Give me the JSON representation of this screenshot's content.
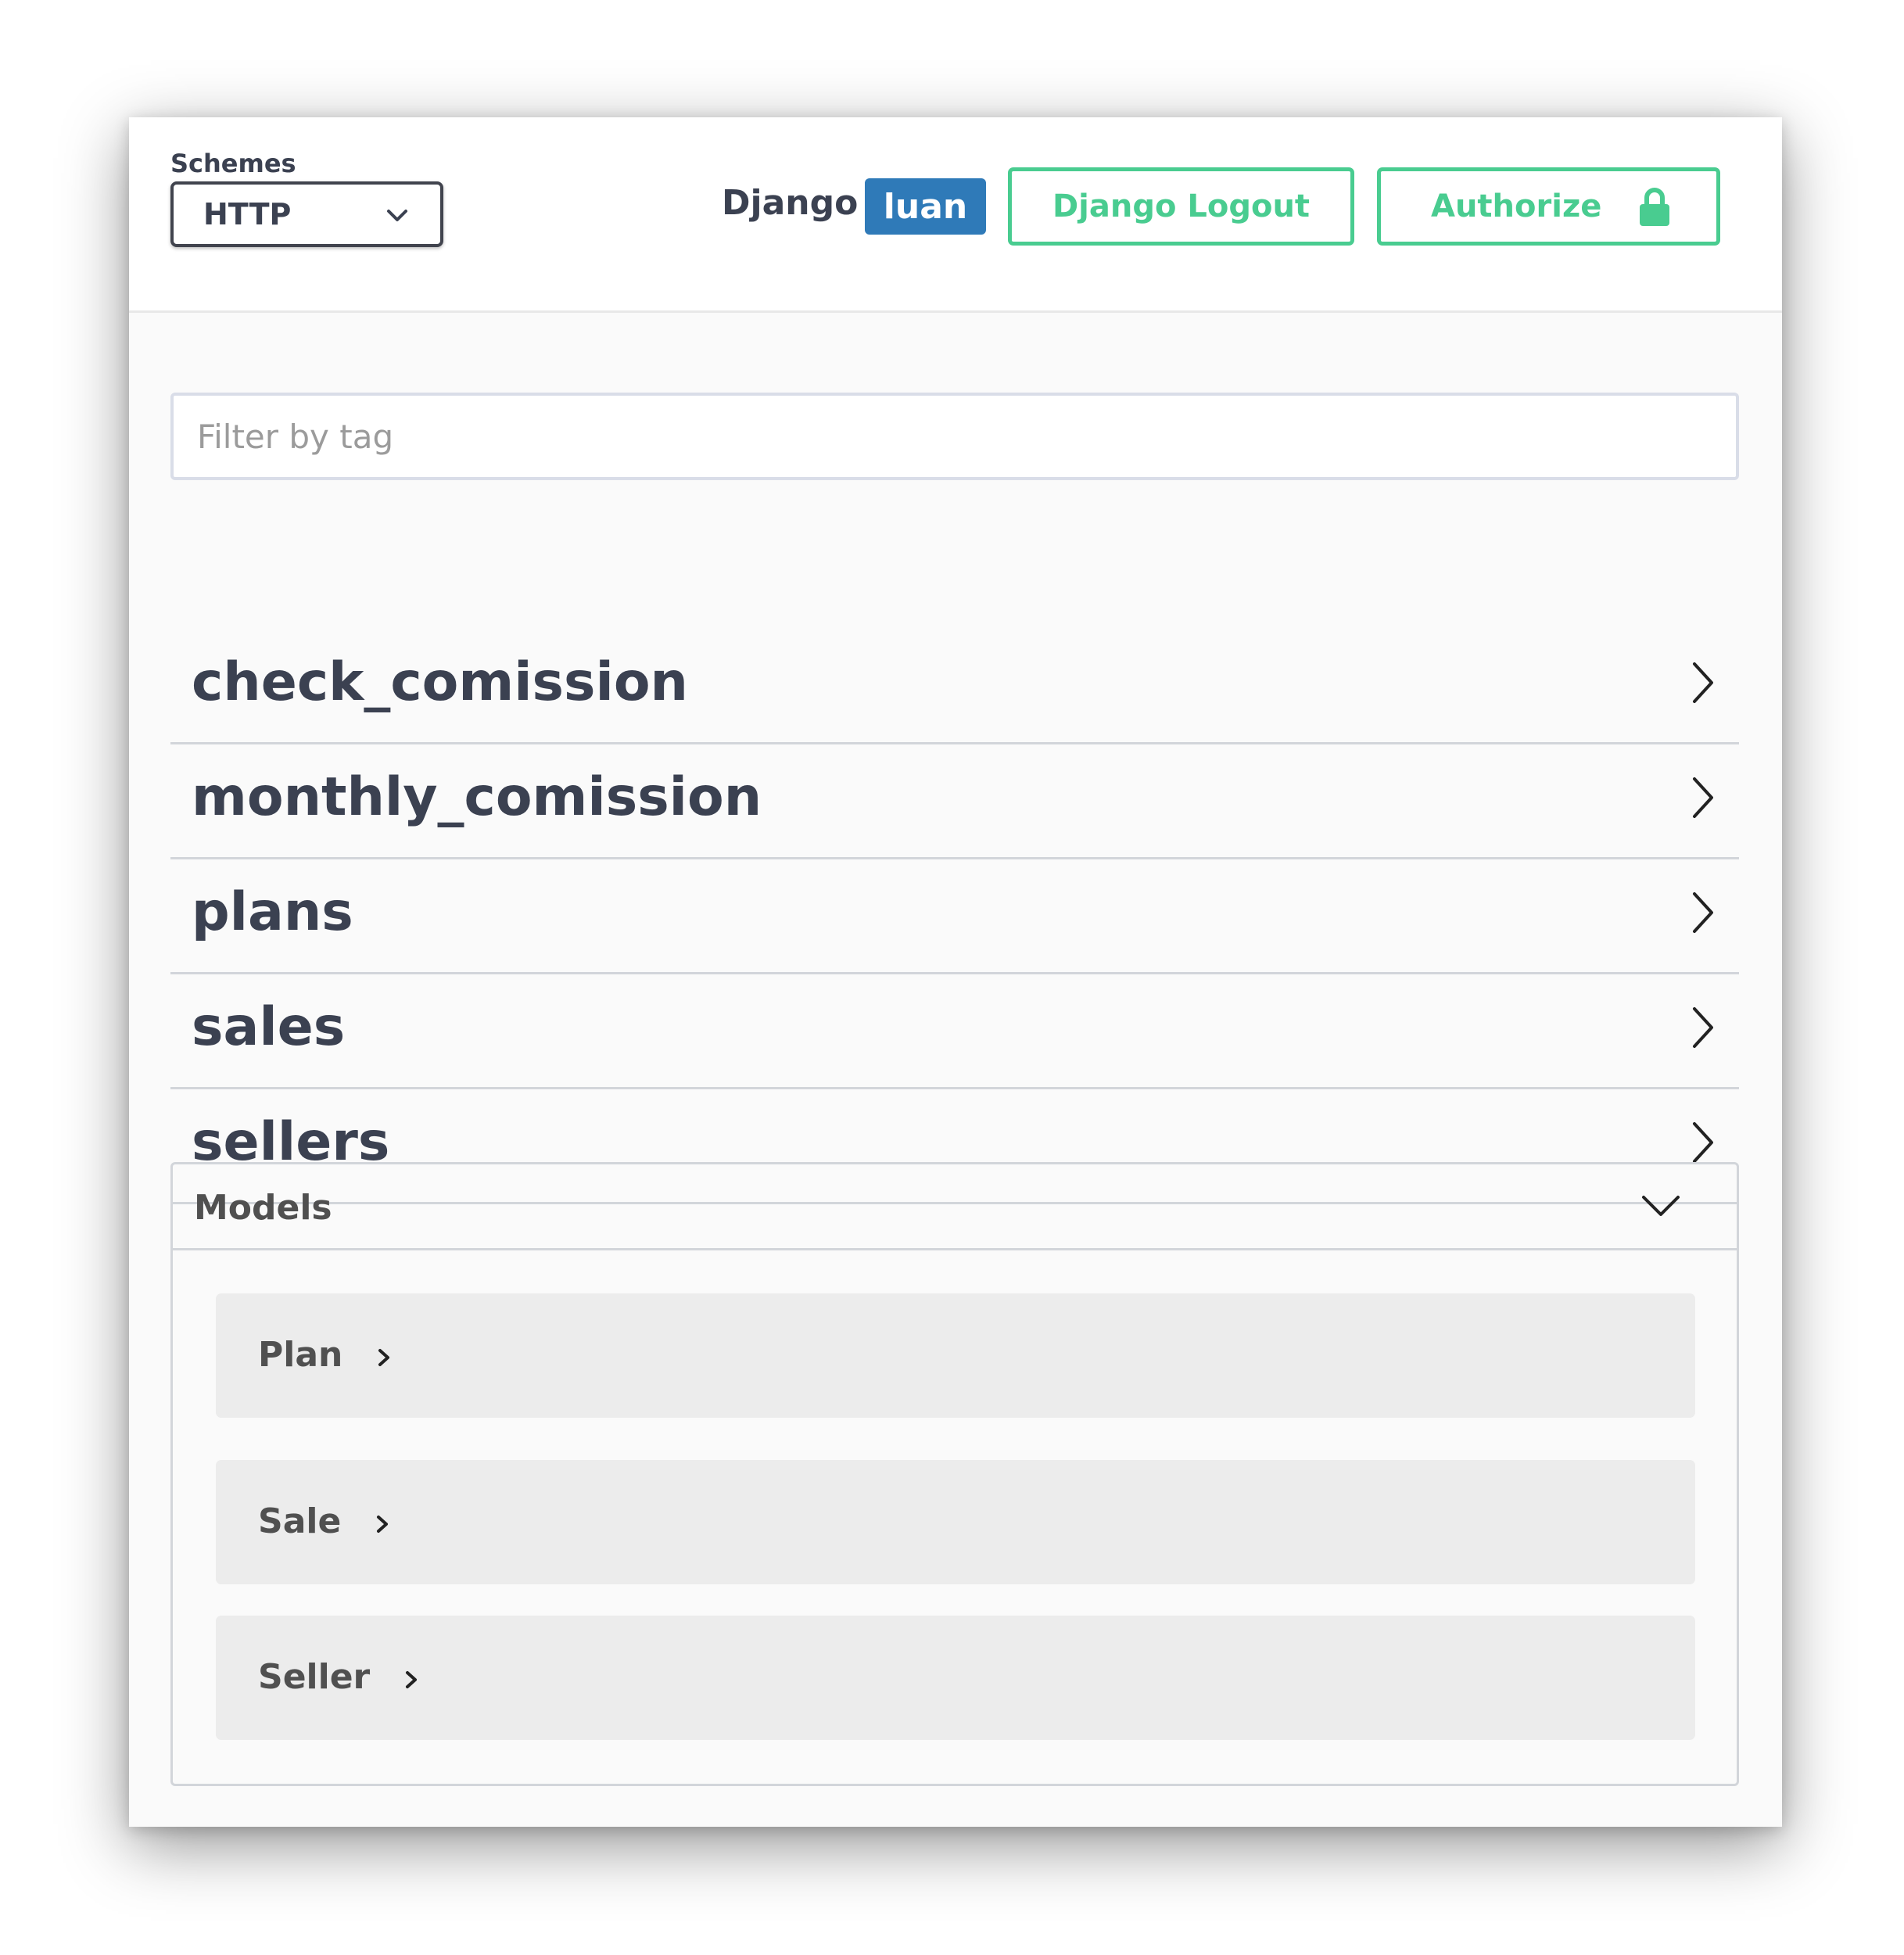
{
  "topbar": {
    "schemes_label": "Schemes",
    "scheme_selected": "HTTP",
    "django_label": "Django",
    "username": "luan",
    "logout_label": "Django Logout",
    "authorize_label": "Authorize"
  },
  "filter": {
    "placeholder": "Filter by tag",
    "value": ""
  },
  "tags": [
    {
      "label": "check_comission"
    },
    {
      "label": "monthly_comission"
    },
    {
      "label": "plans"
    },
    {
      "label": "sales"
    },
    {
      "label": "sellers"
    }
  ],
  "models": {
    "title": "Models",
    "items": [
      {
        "name": "Plan"
      },
      {
        "name": "Sale"
      },
      {
        "name": "Seller"
      }
    ]
  },
  "colors": {
    "accent_green": "#49cc90",
    "badge_blue": "#2f7ab8",
    "text": "#3b4151"
  },
  "icons": {
    "scheme_dropdown": "chevron-down-icon",
    "authorize": "lock-icon",
    "tag_expand": "chevron-right-icon",
    "models_toggle": "chevron-down-icon",
    "model_expand": "chevron-right-icon"
  }
}
